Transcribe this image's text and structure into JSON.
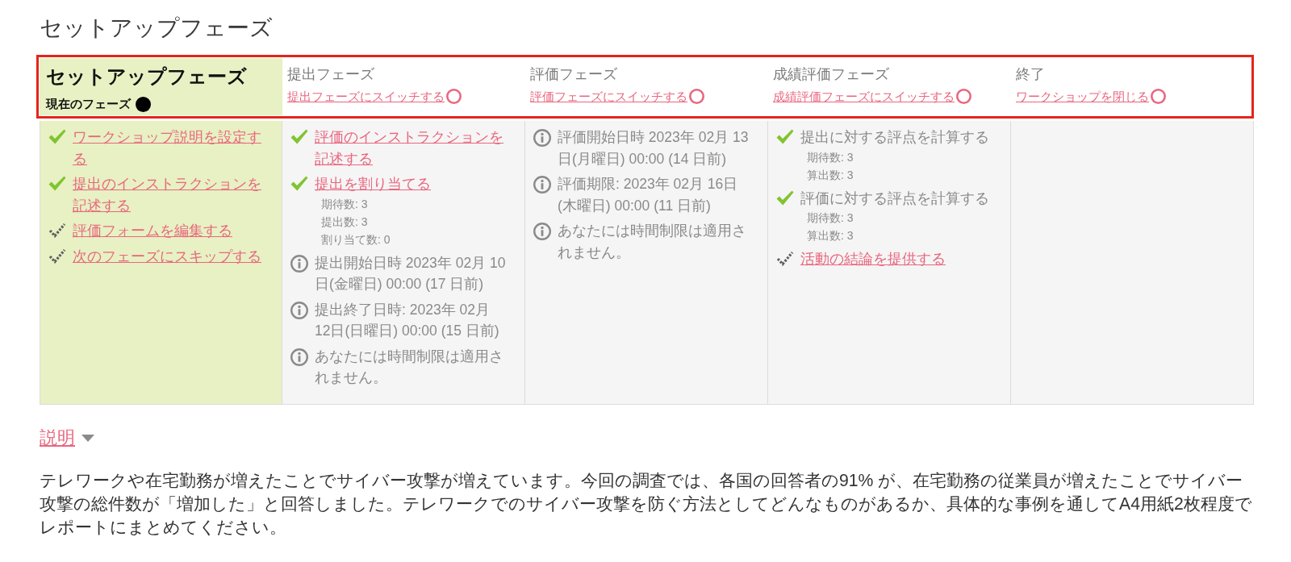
{
  "page_title": "セットアップフェーズ",
  "header_highlighted": true,
  "phases": [
    {
      "title": "セットアップフェーズ",
      "current": true,
      "current_label": "現在のフェーズ",
      "tasks": [
        {
          "kind": "task",
          "text": "ワークショップ説明を設定する",
          "done": true,
          "link": true
        },
        {
          "kind": "task",
          "text": "提出のインストラクションを記述する",
          "done": true,
          "link": true
        },
        {
          "kind": "task",
          "text": "評価フォームを編集する",
          "done": false,
          "link": true
        },
        {
          "kind": "task",
          "text": "次のフェーズにスキップする",
          "done": false,
          "link": true
        }
      ]
    },
    {
      "title": "提出フェーズ",
      "current": false,
      "action": "提出フェーズにスイッチする",
      "tasks": [
        {
          "kind": "task",
          "text": "評価のインストラクションを記述する",
          "done": true,
          "link": true
        },
        {
          "kind": "task",
          "text": "提出を割り当てる",
          "done": true,
          "link": true,
          "details": [
            "期待数: 3",
            "提出数: 3",
            "割り当て数: 0"
          ]
        },
        {
          "kind": "info",
          "text": "提出開始日時 2023年 02月 10日(金曜日) 00:00 (17 日前)"
        },
        {
          "kind": "info",
          "text": "提出終了日時: 2023年 02月 12日(日曜日) 00:00 (15 日前)"
        },
        {
          "kind": "info",
          "text": "あなたには時間制限は適用されません。"
        }
      ]
    },
    {
      "title": "評価フェーズ",
      "current": false,
      "action": "評価フェーズにスイッチする",
      "tasks": [
        {
          "kind": "info",
          "text": "評価開始日時 2023年 02月 13日(月曜日) 00:00 (14 日前)"
        },
        {
          "kind": "info",
          "text": "評価期限: 2023年 02月 16日(木曜日) 00:00 (11 日前)"
        },
        {
          "kind": "info",
          "text": "あなたには時間制限は適用されません。"
        }
      ]
    },
    {
      "title": "成績評価フェーズ",
      "current": false,
      "action": "成績評価フェーズにスイッチする",
      "tasks": [
        {
          "kind": "task",
          "text": "提出に対する評点を計算する",
          "done": true,
          "link": false,
          "details": [
            "期待数: 3",
            "算出数: 3"
          ]
        },
        {
          "kind": "task",
          "text": "評価に対する評点を計算する",
          "done": true,
          "link": false,
          "details": [
            "期待数: 3",
            "算出数: 3"
          ]
        },
        {
          "kind": "task",
          "text": "活動の結論を提供する",
          "done": false,
          "link": true
        }
      ]
    },
    {
      "title": "終了",
      "current": false,
      "action": "ワークショップを閉じる"
    }
  ],
  "description": {
    "toggle": "説明",
    "expanded": true,
    "text": "テレワークや在宅勤務が増えたことでサイバー攻撃が増えています。今回の調査では、各国の回答者の91% が、在宅勤務の従業員が増えたことでサイバー攻撃の総件数が「増加した」と回答しました。テレワークでのサイバー攻撃を防ぐ方法としてどんなものがあるか、具体的な事例を通してA4用紙2枚程度でレポートにまとめてください。"
  }
}
